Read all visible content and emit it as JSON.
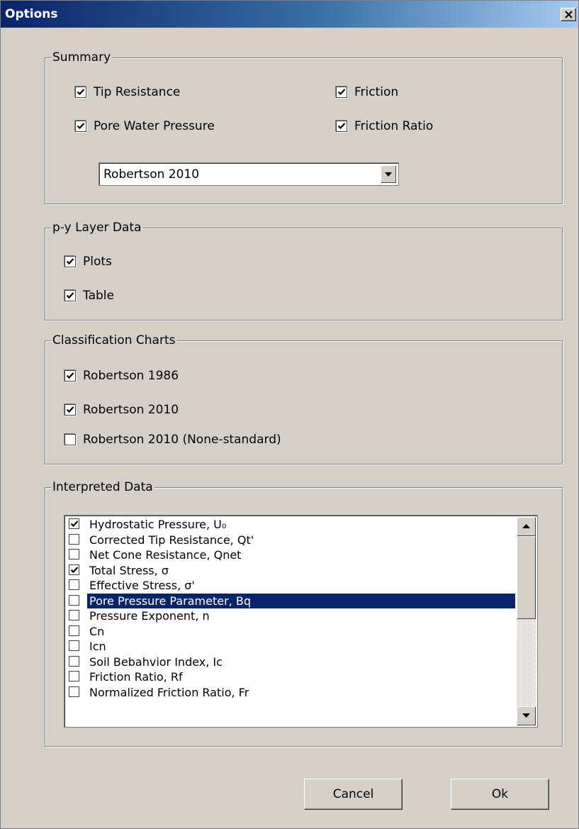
{
  "window": {
    "title": "Options",
    "close_icon": "close-icon"
  },
  "summary": {
    "legend": "Summary",
    "checks": [
      {
        "label": "Tip Resistance",
        "checked": true
      },
      {
        "label": "Friction",
        "checked": true
      },
      {
        "label": "Pore Water Pressure",
        "checked": true
      },
      {
        "label": "Friction Ratio",
        "checked": true
      }
    ],
    "dropdown_value": "Robertson 2010"
  },
  "py_layer": {
    "legend": "p-y Layer Data",
    "checks": [
      {
        "label": "Plots",
        "checked": true
      },
      {
        "label": "Table",
        "checked": true
      }
    ]
  },
  "classification": {
    "legend": "Classification Charts",
    "checks": [
      {
        "label": "Robertson 1986",
        "checked": true
      },
      {
        "label": "Robertson 2010",
        "checked": true
      },
      {
        "label": "Robertson 2010 (None-standard)",
        "checked": false
      }
    ]
  },
  "interpreted": {
    "legend": "Interpreted Data",
    "items": [
      {
        "label": "Hydrostatic Pressure, U₀",
        "checked": true,
        "selected": false
      },
      {
        "label": "Corrected Tip Resistance, Qt'",
        "checked": false,
        "selected": false
      },
      {
        "label": "Net Cone Resistance, Qnet",
        "checked": false,
        "selected": false
      },
      {
        "label": "Total Stress, σ",
        "checked": true,
        "selected": false
      },
      {
        "label": "Effective Stress, σ'",
        "checked": false,
        "selected": false
      },
      {
        "label": "Pore Pressure Parameter, Bq",
        "checked": false,
        "selected": true
      },
      {
        "label": "Pressure Exponent, n",
        "checked": false,
        "selected": false
      },
      {
        "label": "Cn",
        "checked": false,
        "selected": false
      },
      {
        "label": "Icn",
        "checked": false,
        "selected": false
      },
      {
        "label": "Soil Bebahvior Index, Ic",
        "checked": false,
        "selected": false
      },
      {
        "label": "Friction Ratio, Rf",
        "checked": false,
        "selected": false
      },
      {
        "label": "Normalized Friction Ratio, Fr",
        "checked": false,
        "selected": false
      }
    ]
  },
  "buttons": {
    "cancel": "Cancel",
    "ok": "Ok"
  },
  "colors": {
    "selection": "#0a246a",
    "face": "#d4d0c8"
  }
}
